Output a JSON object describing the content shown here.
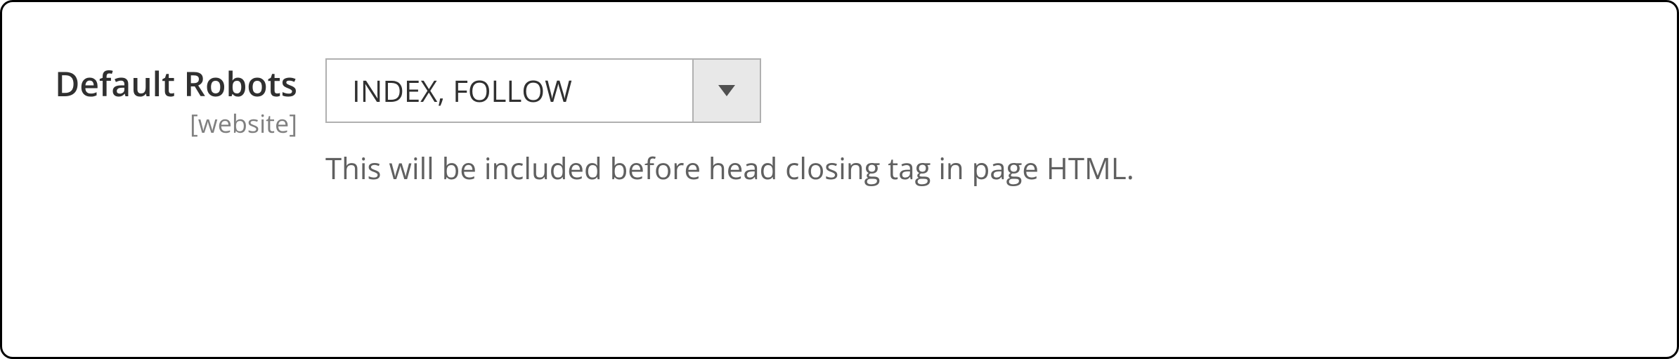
{
  "field": {
    "label": "Default Robots",
    "scope": "[website]",
    "selected_value": "INDEX, FOLLOW",
    "help_text": "This will be included before head closing tag in page HTML."
  }
}
